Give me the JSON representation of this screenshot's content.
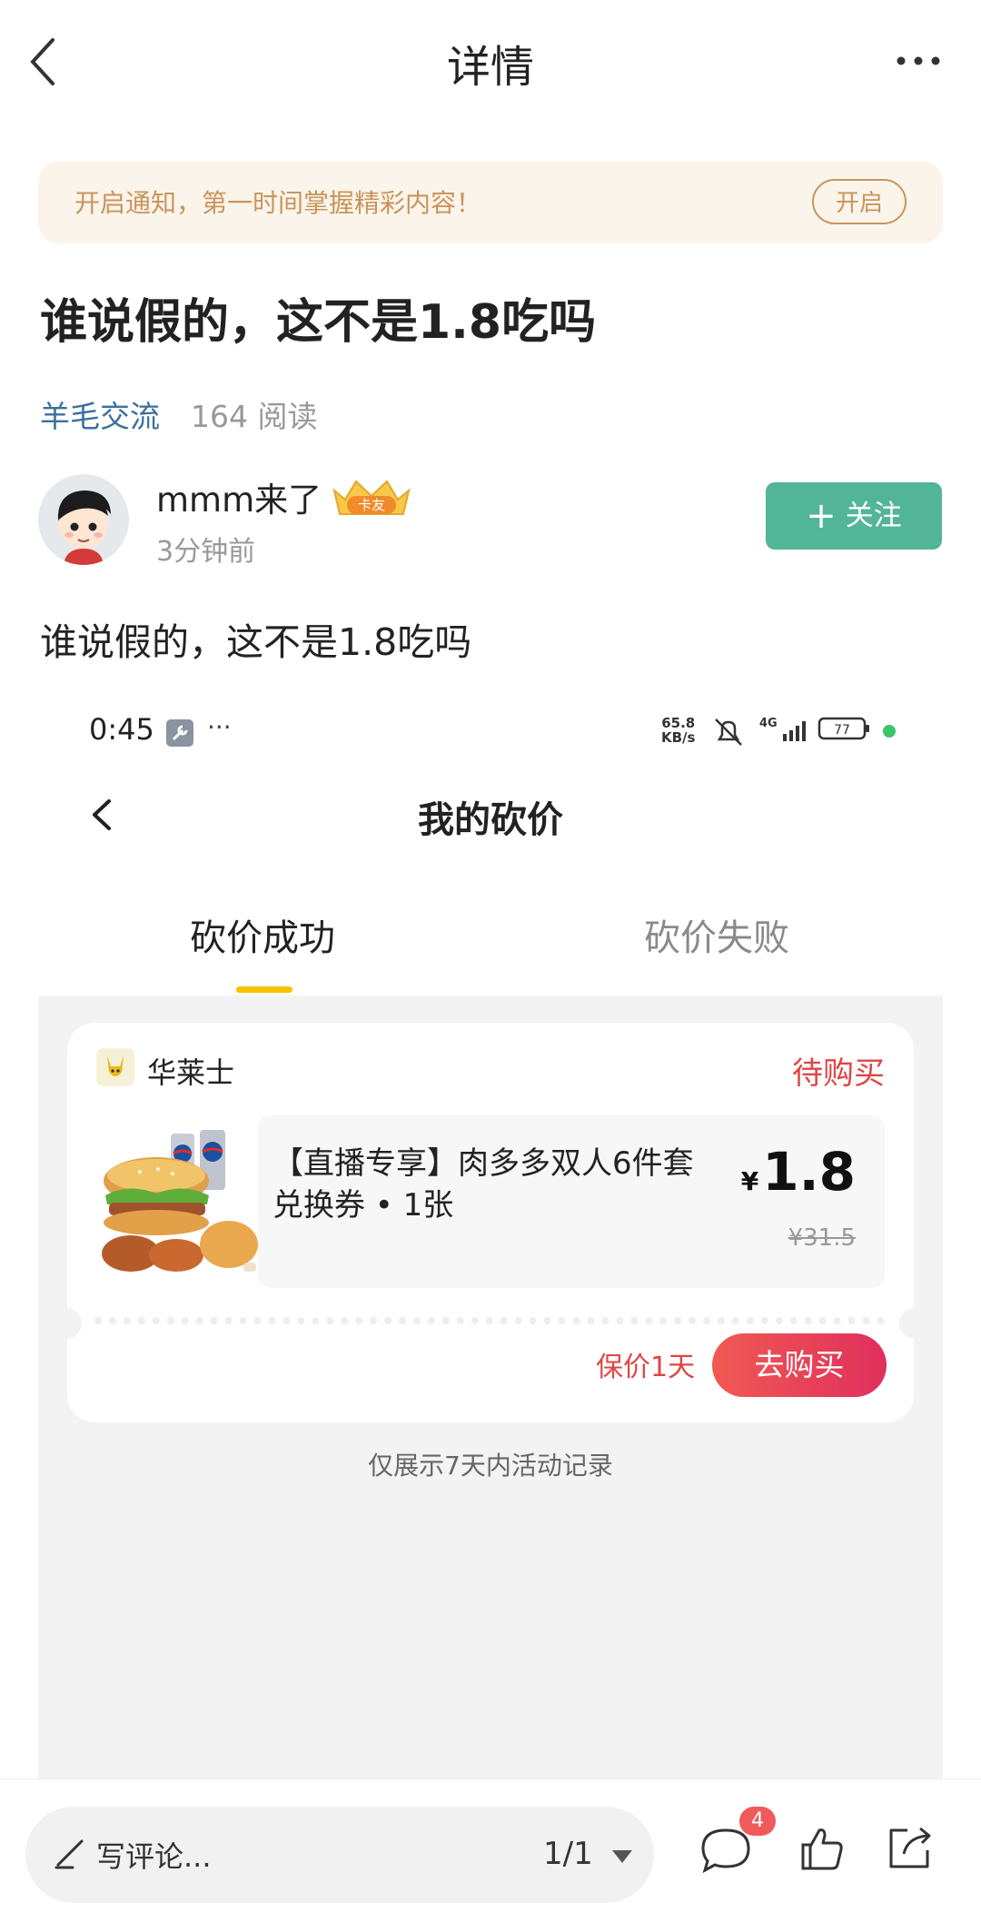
{
  "header": {
    "title": "详情"
  },
  "notify": {
    "text": "开启通知，第一时间掌握精彩内容！",
    "button": "开启"
  },
  "post": {
    "title": "谁说假的，这不是1.8吃吗",
    "tag": "羊毛交流",
    "reads": "164 阅读",
    "author": {
      "name": "mmm来了",
      "badge": "卡友",
      "time": "3分钟前"
    },
    "follow_label": "关注",
    "body": "谁说假的，这不是1.8吃吗"
  },
  "screenshot": {
    "status_bar": {
      "time": "0:45",
      "speed_value": "65.8",
      "speed_unit": "KB/s",
      "network": "4G",
      "battery": "77"
    },
    "title": "我的砍价",
    "tabs": [
      {
        "label": "砍价成功"
      },
      {
        "label": "砍价失败"
      }
    ],
    "card": {
      "shop": "华莱士",
      "status": "待购买",
      "product_name": "【直播专享】肉多多双人6件套兑换券 • 1张",
      "currency": "¥",
      "price": "1.8",
      "original_price": "¥31.5",
      "protect": "保价1天",
      "buy_button": "去购买"
    },
    "note": "仅展示7天内活动记录"
  },
  "bottom": {
    "comment_placeholder": "写评论...",
    "page_indicator": "1/1",
    "comment_count": "4"
  },
  "colors": {
    "follow": "#52b597",
    "accent_red": "#e04545",
    "tab_indicator": "#f5c400",
    "tag_blue": "#3c6f9c"
  }
}
